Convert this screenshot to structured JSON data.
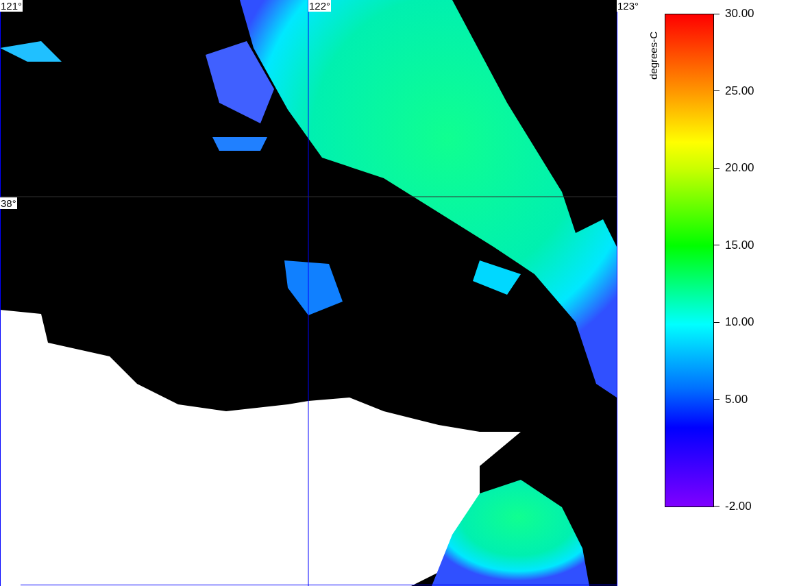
{
  "map": {
    "grid_labels": [
      {
        "text": "121°",
        "kind": "lon"
      },
      {
        "text": "122°",
        "kind": "lon"
      },
      {
        "text": "123°",
        "kind": "lon"
      },
      {
        "text": "38°",
        "kind": "lat"
      }
    ]
  },
  "colorbar": {
    "title": "degrees-C",
    "ticks": [
      "30.00",
      "25.00",
      "20.00",
      "15.00",
      "10.00",
      "5.00",
      "-2.00"
    ]
  }
}
